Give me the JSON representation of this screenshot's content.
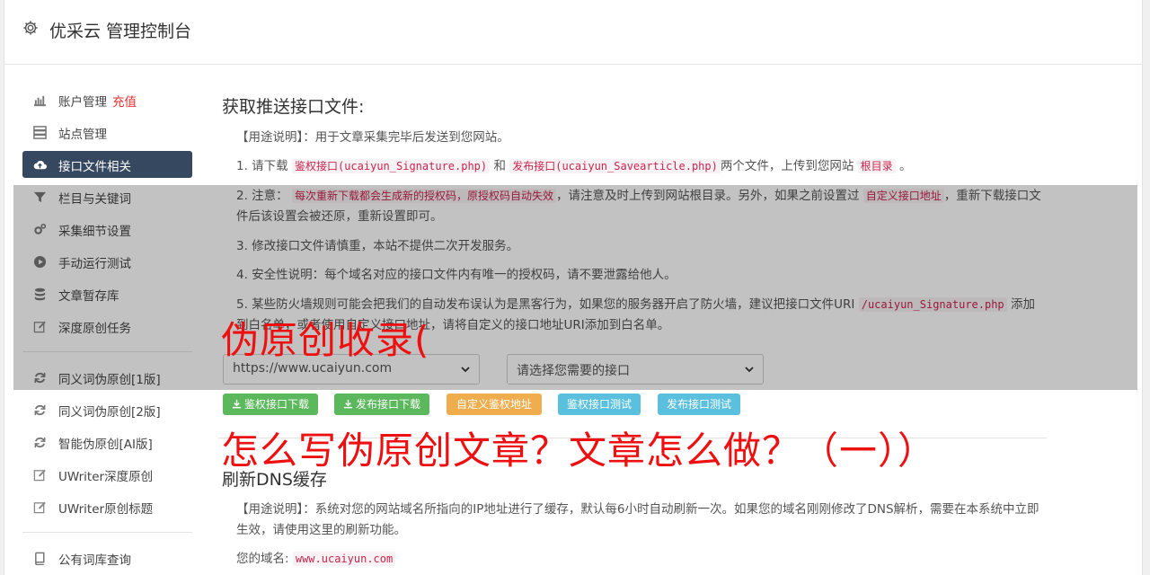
{
  "header": {
    "title": "优采云 管理控制台",
    "icon": "gear-icon"
  },
  "sidebar": {
    "items": [
      {
        "label": "账户管理",
        "extra": "充值",
        "icon": "bar-chart-icon"
      },
      {
        "label": "站点管理",
        "icon": "server-icon"
      },
      {
        "label": "接口文件相关",
        "icon": "cloud-upload-icon",
        "active": true
      },
      {
        "label": "栏目与关键词",
        "icon": "filter-icon"
      },
      {
        "label": "采集细节设置",
        "icon": "cogs-icon"
      },
      {
        "label": "手动运行测试",
        "icon": "play-circle-icon"
      },
      {
        "label": "文章暂存库",
        "icon": "database-icon"
      },
      {
        "label": "深度原创任务",
        "icon": "edit-icon"
      },
      {
        "label": "同义词伪原创[1版]",
        "icon": "refresh-icon"
      },
      {
        "label": "同义词伪原创[2版]",
        "icon": "refresh-icon"
      },
      {
        "label": "智能伪原创[AI版]",
        "icon": "refresh-icon"
      },
      {
        "label": "UWriter深度原创",
        "icon": "edit-icon"
      },
      {
        "label": "UWriter原创标题",
        "icon": "edit-icon"
      },
      {
        "label": "公有词库查询",
        "icon": "book-icon"
      }
    ]
  },
  "section1": {
    "title": "获取推送接口文件:",
    "usage_label": "【用途说明】",
    "usage_text": "：用于文章采集完毕后发送到您网站。",
    "step1": {
      "prefix": "1. 请下载",
      "code1": "鉴权接口(ucaiyun_Signature.php)",
      "mid": "和",
      "code2": "发布接口(ucaiyun_Savearticle.php)",
      "suffix": "两个文件，上传到您网站",
      "code3": "根目录",
      "end": "。"
    },
    "step2": {
      "prefix": "2. 注意：",
      "code1": "每次重新下载都会生成新的授权码，原授权码自动失效",
      "mid": "，请注意及时上传到网站根目录。另外，如果之前设置过",
      "code2": "自定义接口地址",
      "suffix": "，重新下载接口文件后该设置会被还原，重新设置即可。"
    },
    "step3": "3. 修改接口文件请慎重，本站不提供二次开发服务。",
    "step4": "4. 安全性说明：每个域名对应的接口文件内有唯一的授权码，请不要泄露给他人。",
    "step5": {
      "prefix": "5. 某些防火墙规则可能会把我们的自动发布误认为是黑客行为，如果您的服务器开启了防火墙，建议把接口文件URI",
      "code1": "/ucaiyun_Signature.php",
      "suffix": "添加到白名单，或者使用自定义接口地址，请将自定义的接口地址URI添加到白名单。"
    },
    "site_select": "https://www.ucaiyun.com",
    "api_select": "请选择您需要的接口",
    "buttons": {
      "download_auth": "鉴权接口下载",
      "download_publish": "发布接口下载",
      "custom_auth": "自定义鉴权地址",
      "test_auth": "鉴权接口测试",
      "test_publish": "发布接口测试"
    }
  },
  "section2": {
    "title": "刷新DNS缓存",
    "usage_label": "【用途说明】",
    "usage_text": "：系统对您的网站域名所指向的IP地址进行了缓存，默认每6小时自动刷新一次。如果您的域名刚刚修改了DNS解析，需要在本系统中立即生效，请使用这里的刷新功能。",
    "domain_label": "您的域名:",
    "domain_value": "www.ucaiyun.com"
  },
  "overlay": {
    "line1": "伪原创收录(",
    "line2": "怎么写伪原创文章？文章怎么做？（一））",
    "color": "#ee1010"
  }
}
